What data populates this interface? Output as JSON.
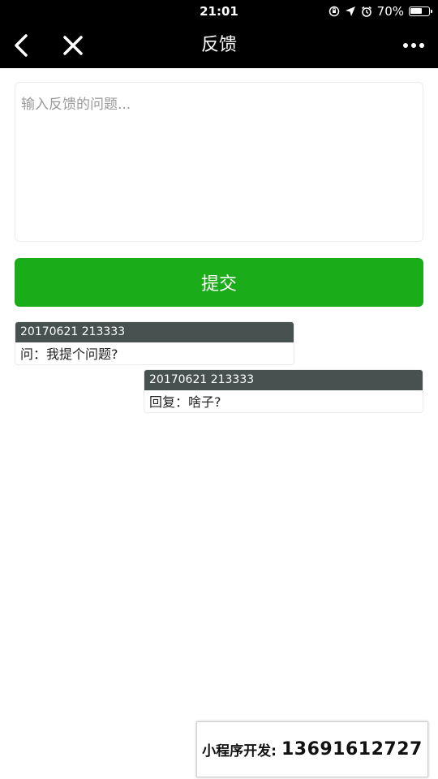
{
  "status_bar": {
    "time": "21:01",
    "battery_text": "70%",
    "battery_level": 0.7,
    "icons": [
      "orientation-lock-icon",
      "location-arrow-icon",
      "alarm-icon",
      "battery-icon"
    ]
  },
  "nav": {
    "title": "反馈",
    "icons": [
      "back-chevron-icon",
      "close-icon",
      "more-dots-icon"
    ]
  },
  "feedback": {
    "placeholder": "输入反馈的问题...",
    "value": ""
  },
  "submit": {
    "label": "提交",
    "color": "#1aad19"
  },
  "messages": [
    {
      "time": "20170621 213333",
      "text": "问：我提个问题?"
    },
    {
      "time": "20170621 213333",
      "text": "回复：啥子?"
    }
  ],
  "promo": {
    "label": "小程序开发:",
    "number": "13691612727"
  },
  "colors": {
    "message_header": "#465150",
    "bar_background": "#000000"
  }
}
